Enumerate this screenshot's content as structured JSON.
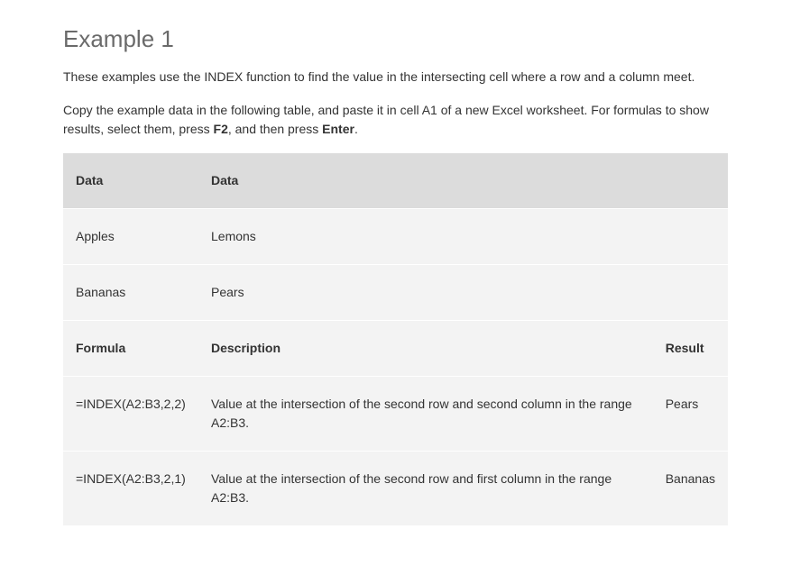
{
  "heading": "Example 1",
  "paragraph1": "These examples use the INDEX function to find the value in the intersecting cell where a row and a column meet.",
  "paragraph2_prefix": "Copy the example data in the following table, and paste it in cell A1 of a new Excel worksheet. For formulas to show results, select them, press ",
  "paragraph2_bold1": "F2",
  "paragraph2_mid": ", and then press ",
  "paragraph2_bold2": "Enter",
  "paragraph2_suffix": ".",
  "table": {
    "header1": {
      "c1": "Data",
      "c2": "Data",
      "c3": ""
    },
    "row1": {
      "c1": "Apples",
      "c2": "Lemons",
      "c3": ""
    },
    "row2": {
      "c1": "Bananas",
      "c2": "Pears",
      "c3": ""
    },
    "header2": {
      "c1": "Formula",
      "c2": "Description",
      "c3": "Result"
    },
    "row3": {
      "c1": "=INDEX(A2:B3,2,2)",
      "c2": "Value at the intersection of the second row and second column in the range A2:B3.",
      "c3": "Pears"
    },
    "row4": {
      "c1": "=INDEX(A2:B3,2,1)",
      "c2": "Value at the intersection of the second row and first column in the range A2:B3.",
      "c3": "Bananas"
    }
  }
}
